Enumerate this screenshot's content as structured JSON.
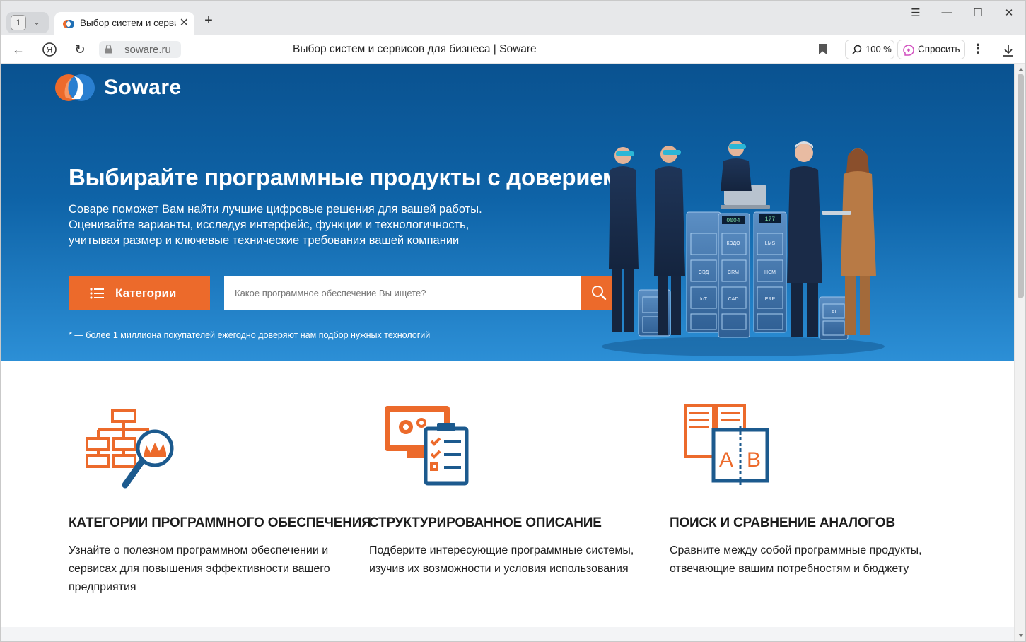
{
  "browser": {
    "tab_count": "1",
    "tab_title": "Выбор систем и серви",
    "address_host": "soware.ru",
    "page_title": "Выбор систем и сервисов для бизнеса | Soware",
    "zoom": "100 %",
    "ask_label": "Спросить"
  },
  "hero": {
    "logo_text": "Soware",
    "title": "Выбирайте программные продукты с доверием*",
    "desc_lines": [
      "Соваре поможет Вам найти лучшие цифровые решения для вашей работы.",
      "Оценивайте варианты, исследуя интерфейс, функции и технологичность,",
      "учитывая размер и ключевые технические требования вашей компании"
    ],
    "categories_label": "Категории",
    "search_placeholder": "Какое программное обеспечение Вы ищете?",
    "footnote": "* — более 1 миллиона покупателей ежегодно доверяют нам подбор нужных технологий",
    "cabinet_labels": [
      "0004",
      "177",
      "КЭДО",
      "LMS",
      "СЭД",
      "CRM",
      "HCM",
      "IoT",
      "CAD",
      "ERP",
      "AI"
    ]
  },
  "features": [
    {
      "title": "КАТЕГОРИИ ПРОГРАММНОГО ОБЕСПЕЧЕНИЯ",
      "text": "Узнайте о полезном программном обеспечении и сервисах для повышения эффективности вашего предприятия"
    },
    {
      "title": "СТРУКТУРИРОВАННОЕ ОПИСАНИЕ",
      "text": "Подберите интересующие программные системы, изучив их возможности и условия использования"
    },
    {
      "title": "ПОИСК И СРАВНЕНИЕ АНАЛОГОВ",
      "text": "Сравните между собой программные продукты, отвечающие вашим потребностям и бюджету"
    }
  ],
  "colors": {
    "accent": "#ec6a2b",
    "hero_top": "#0a5290",
    "hero_bottom": "#2c8fd6",
    "icon_blue": "#1c5a8e"
  }
}
